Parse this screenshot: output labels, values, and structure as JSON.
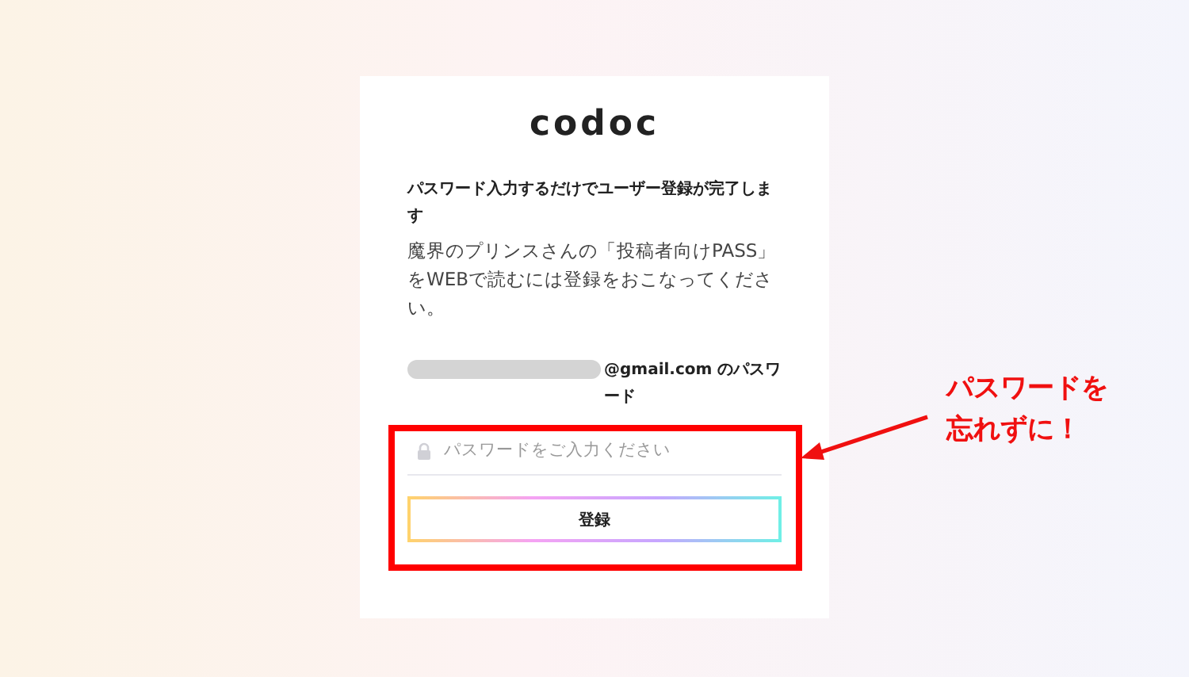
{
  "logo": "codoc",
  "heading": "パスワード入力するだけでユーザー登録が完了します",
  "description": "魔界のプリンスさんの「投稿者向けPASS」をWEBで読むには登録をおこなってください。",
  "email_label": "@gmail.com のパスワード",
  "password_field": {
    "placeholder": "パスワードをご入力ください"
  },
  "register_button": "登録",
  "callout": {
    "lines": [
      "パスワードを",
      "忘れずに！"
    ]
  }
}
